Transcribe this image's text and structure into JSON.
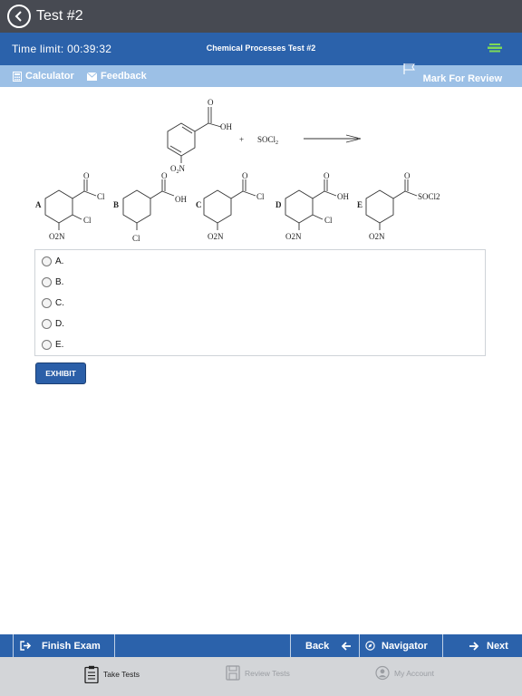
{
  "header": {
    "title": "Test #2"
  },
  "info": {
    "time_limit": "Time limit: 00:39:32",
    "test_name": "Chemical Processes Test #2"
  },
  "toolbar": {
    "calculator": "Calculator",
    "feedback": "Feedback",
    "mark_for_review": "Mark For Review"
  },
  "question": {
    "reagent": "SOCl",
    "reagent_sub": "2",
    "oh": "OH",
    "o2n": "O",
    "o2n_sub": "2",
    "n": "N",
    "choices": [
      {
        "letter": "A",
        "sub1": "Cl",
        "sub2": "Cl",
        "sub3": "O2N"
      },
      {
        "letter": "B",
        "sub1": "OH",
        "sub2": "Cl"
      },
      {
        "letter": "C",
        "sub1": "Cl",
        "sub2": "O2N"
      },
      {
        "letter": "D",
        "sub1": "OH",
        "sub2": "Cl",
        "sub3": "O2N"
      },
      {
        "letter": "E",
        "sub1": "SOCl2",
        "sub2": "O2N"
      }
    ]
  },
  "answers": [
    {
      "label": "A."
    },
    {
      "label": "B."
    },
    {
      "label": "C."
    },
    {
      "label": "D."
    },
    {
      "label": "E."
    }
  ],
  "exhibit_label": "EXHIBIT",
  "nav": {
    "finish": "Finish Exam",
    "back": "Back",
    "navigator": "Navigator",
    "next": "Next"
  },
  "tabs": {
    "take": "Take Tests",
    "review": "Review Tests",
    "account": "My Account"
  },
  "colors": {
    "header": "#474a52",
    "info_bar": "#2b62ab",
    "tool_bar": "#9cc0e6",
    "tab_bar": "#d3d5d8"
  }
}
